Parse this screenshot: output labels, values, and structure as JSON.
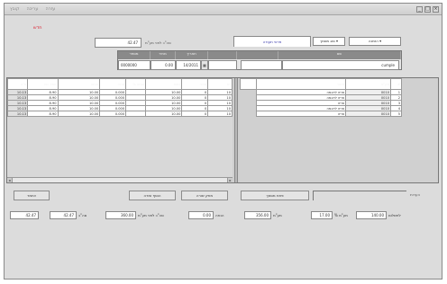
{
  "window": {
    "menu": [
      "קובץ",
      "עריכה",
      "עזרה"
    ],
    "controls": [
      "_",
      "□",
      "×"
    ]
  },
  "form": {
    "red_label": "חדש",
    "total_value": "42.47",
    "total_label": "סה\"כ לפני מע\"מ",
    "tab_active": "פרטי תעודה",
    "dropdown_1": "סוג מסמך",
    "dropdown_2": "הזמנה",
    "header_fields": {
      "labels": [
        "מספר",
        "מחיר",
        "תאריך",
        "",
        "",
        "שם"
      ],
      "values": [
        "0000000",
        "0.00",
        "14/2011",
        "",
        "",
        "cumple"
      ]
    }
  },
  "left_grid": {
    "headers": [
      "ס\"ה",
      "מחיר נטו",
      "הנחה",
      "מחיר",
      "% הנחה",
      "כמות",
      "מחיר",
      "יח'",
      "סה\"כ"
    ],
    "rows": [
      [
        "10.13",
        "8.90",
        "10.00",
        "0.000",
        "",
        "10.00",
        "0",
        "10"
      ],
      [
        "10.13",
        "8.90",
        "10.00",
        "0.000",
        "",
        "10.00",
        "0",
        "10"
      ],
      [
        "10.13",
        "8.90",
        "10.00",
        "0.000",
        "",
        "10.00",
        "0",
        "10"
      ],
      [
        "10.13",
        "8.90",
        "10.00",
        "0.000",
        "",
        "10.00",
        "0",
        "10"
      ],
      [
        "10.13",
        "8.90",
        "10.00",
        "0.000",
        "",
        "10.00",
        "0",
        "10"
      ]
    ]
  },
  "right_grid": {
    "headers": [
      "",
      "תיאור",
      "מק\"ט",
      "#"
    ],
    "rows": [
      [
        "",
        "פריט לדוגמה",
        "0010",
        "1"
      ],
      [
        "",
        "פריט לדוגמה",
        "0010",
        "2"
      ],
      [
        "",
        "פריט",
        "0010",
        "3"
      ],
      [
        "",
        "פריט לדוגמה",
        "0010",
        "4"
      ],
      [
        "",
        "פריט",
        "0010",
        "5"
      ]
    ]
  },
  "buttons": {
    "b1": "אישור",
    "b2": "הוסף שורה",
    "b3": "מחק שורה",
    "b4": "פתח מסמך",
    "side_label": "הערות"
  },
  "totals": [
    {
      "value": "42.47",
      "label": ""
    },
    {
      "value": "42.47",
      "label": "סה\"כ"
    },
    {
      "value": "360.00",
      "label": "סה\"כ לפני מע\"מ"
    },
    {
      "value": "0.00",
      "label": "הנחה"
    },
    {
      "value": "356.00",
      "label": "מע\"מ"
    },
    {
      "value": "17.00",
      "label": "% מע\"מ"
    },
    {
      "value": "140.00",
      "label": "לתשלום"
    }
  ]
}
